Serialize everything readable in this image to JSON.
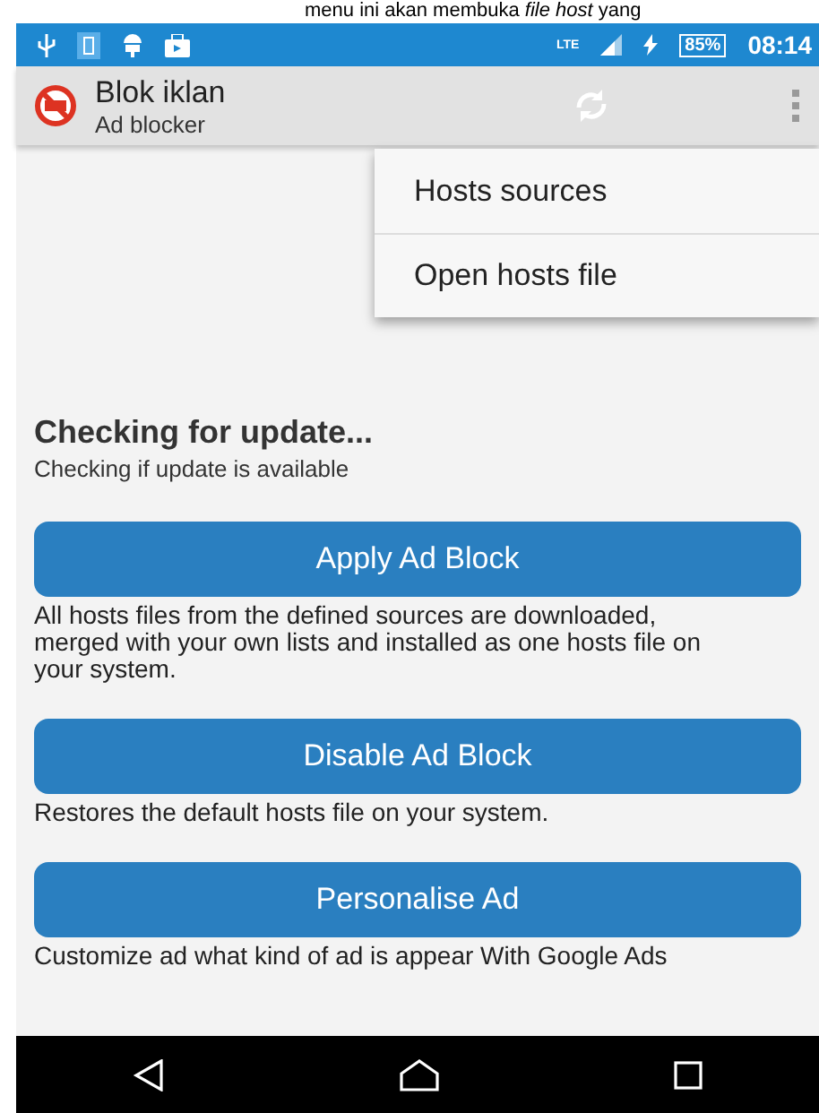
{
  "caption": "menu ini akan membuka *file host* yang",
  "status_bar": {
    "network": "LTE",
    "battery": "85%",
    "time": "08:14"
  },
  "toolbar": {
    "title": "Blok iklan",
    "subtitle": "Ad blocker"
  },
  "overflow_menu": [
    {
      "label": "Hosts sources"
    },
    {
      "label": "Open hosts file"
    }
  ],
  "status": {
    "title": "Checking for update...",
    "subtitle": "Checking if update is available"
  },
  "actions": [
    {
      "label": "Apply Ad Block",
      "description": "All hosts files from the defined sources are downloaded, merged with your own lists and installed as one hosts file on your system."
    },
    {
      "label": "Disable Ad Block",
      "description": "Restores the default hosts file on your system."
    },
    {
      "label": "Personalise Ad",
      "description": "Customize ad what kind of ad is appear With Google Ads"
    }
  ]
}
